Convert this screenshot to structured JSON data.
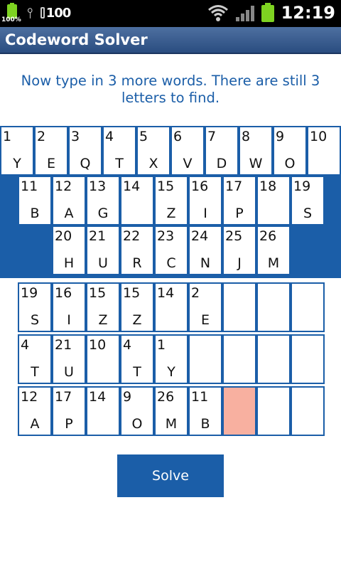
{
  "status_bar": {
    "battery_small_pct": "100%",
    "sd_label": "100",
    "time": "12:19"
  },
  "title_bar": {
    "title": "Codeword Solver"
  },
  "instruction": "Now type in 3 more words. There are still 3 letters to find.",
  "key": [
    {
      "num": "1",
      "letter": "Y"
    },
    {
      "num": "2",
      "letter": "E"
    },
    {
      "num": "3",
      "letter": "Q"
    },
    {
      "num": "4",
      "letter": "T"
    },
    {
      "num": "5",
      "letter": "X"
    },
    {
      "num": "6",
      "letter": "V"
    },
    {
      "num": "7",
      "letter": "D"
    },
    {
      "num": "8",
      "letter": "W"
    },
    {
      "num": "9",
      "letter": "O"
    },
    {
      "num": "10",
      "letter": ""
    },
    {
      "num": "11",
      "letter": "B"
    },
    {
      "num": "12",
      "letter": "A"
    },
    {
      "num": "13",
      "letter": "G"
    },
    {
      "num": "14",
      "letter": ""
    },
    {
      "num": "15",
      "letter": "Z"
    },
    {
      "num": "16",
      "letter": "I"
    },
    {
      "num": "17",
      "letter": "P"
    },
    {
      "num": "18",
      "letter": ""
    },
    {
      "num": "19",
      "letter": "S"
    },
    {
      "num": "20",
      "letter": "H"
    },
    {
      "num": "21",
      "letter": "U"
    },
    {
      "num": "22",
      "letter": "R"
    },
    {
      "num": "23",
      "letter": "C"
    },
    {
      "num": "24",
      "letter": "N"
    },
    {
      "num": "25",
      "letter": "J"
    },
    {
      "num": "26",
      "letter": "M"
    }
  ],
  "words": [
    [
      {
        "num": "19",
        "letter": "S"
      },
      {
        "num": "16",
        "letter": "I"
      },
      {
        "num": "15",
        "letter": "Z"
      },
      {
        "num": "15",
        "letter": "Z"
      },
      {
        "num": "14",
        "letter": ""
      },
      {
        "num": "2",
        "letter": "E"
      },
      {
        "num": "",
        "letter": ""
      },
      {
        "num": "",
        "letter": ""
      },
      {
        "num": "",
        "letter": ""
      }
    ],
    [
      {
        "num": "4",
        "letter": "T"
      },
      {
        "num": "21",
        "letter": "U"
      },
      {
        "num": "10",
        "letter": ""
      },
      {
        "num": "4",
        "letter": "T"
      },
      {
        "num": "1",
        "letter": "Y"
      },
      {
        "num": "",
        "letter": ""
      },
      {
        "num": "",
        "letter": ""
      },
      {
        "num": "",
        "letter": ""
      },
      {
        "num": "",
        "letter": ""
      }
    ],
    [
      {
        "num": "12",
        "letter": "A"
      },
      {
        "num": "17",
        "letter": "P"
      },
      {
        "num": "14",
        "letter": ""
      },
      {
        "num": "9",
        "letter": "O"
      },
      {
        "num": "26",
        "letter": "M"
      },
      {
        "num": "11",
        "letter": "B"
      },
      {
        "num": "",
        "letter": "",
        "highlighted": true
      },
      {
        "num": "",
        "letter": ""
      },
      {
        "num": "",
        "letter": ""
      }
    ]
  ],
  "solve_label": "Solve",
  "colors": {
    "accent": "#1b5ea8",
    "highlight": "#f8b0a0",
    "battery": "#7ed321"
  },
  "icons": [
    "battery-icon",
    "usb-icon",
    "sd-card-icon",
    "wifi-icon",
    "signal-icon"
  ]
}
